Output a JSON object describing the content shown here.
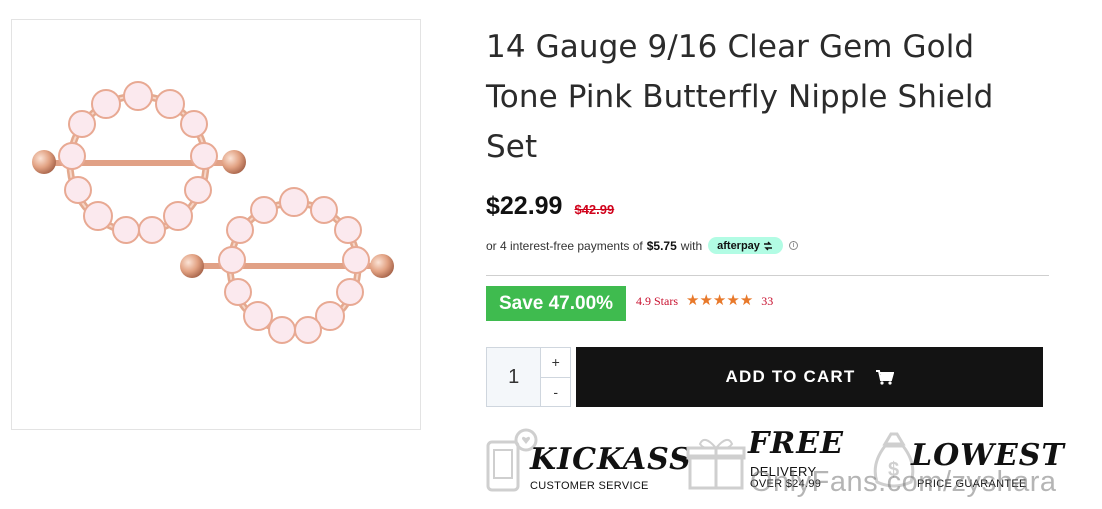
{
  "product": {
    "title": "14 Gauge 9/16 Clear Gem Gold Tone Pink Butterfly Nipple Shield Set",
    "image_alt": "pink butterfly nipple shield set"
  },
  "pricing": {
    "price": "$22.99",
    "old_price": "$42.99",
    "afterpay_prefix": "or 4 interest-free payments of",
    "afterpay_amount": "$5.75",
    "afterpay_with": "with",
    "afterpay_brand": "afterpay",
    "save_label": "Save 47.00%"
  },
  "rating": {
    "label": "4.9 Stars",
    "stars": 5,
    "count": "33"
  },
  "cart": {
    "quantity": "1",
    "plus": "+",
    "minus": "-",
    "add_label": "ADD TO CART"
  },
  "features": [
    {
      "head": "KICKASS",
      "sub": "CUSTOMER SERVICE",
      "icon": "phone-heart-icon"
    },
    {
      "head": "FREE",
      "sub": "DELIVERY",
      "sub2": "OVER $24.99",
      "icon": "gift-box-icon"
    },
    {
      "head": "LOWEST",
      "sub": "PRICE GUARANTEE",
      "icon": "money-bag-icon"
    }
  ],
  "watermark": "OnlyFans.com/zyshara",
  "colors": {
    "save_green": "#3fbb4f",
    "old_price_red": "#d0021b",
    "star_orange": "#e8792b",
    "afterpay_mint": "#b2fce4",
    "button_black": "#131313"
  }
}
